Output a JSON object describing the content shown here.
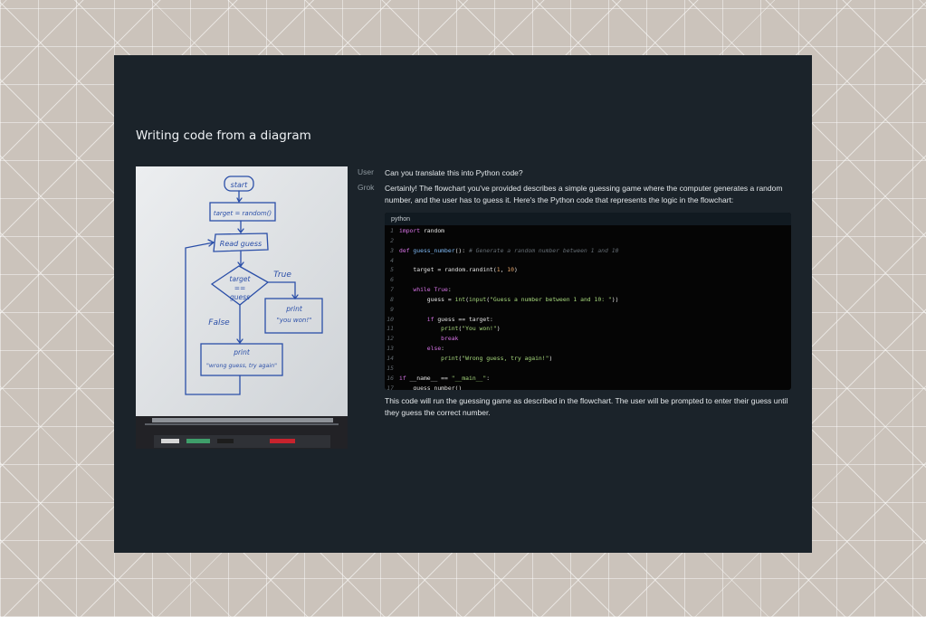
{
  "page": {
    "title": "Writing code from a diagram"
  },
  "chat": {
    "user_role": "User",
    "user_message": "Can you translate this into Python code?",
    "assistant_role": "Grok",
    "assistant_intro": "Certainly! The flowchart you've provided describes a simple guessing game where the computer generates a random number, and the user has to guess it. Here's the Python code that represents the logic in the flowchart:",
    "assistant_outro": "This code will run the guessing game as described in the flowchart. The user will be prompted to enter their guess until they guess the correct number."
  },
  "code_block": {
    "language": "python",
    "lines": [
      {
        "n": "1",
        "text": "import random"
      },
      {
        "n": "2",
        "text": ""
      },
      {
        "n": "3",
        "text": "def guess_number(): # Generate a random number between 1 and 10"
      },
      {
        "n": "4",
        "text": ""
      },
      {
        "n": "5",
        "text": "    target = random.randint(1, 10)"
      },
      {
        "n": "6",
        "text": ""
      },
      {
        "n": "7",
        "text": "    while True:"
      },
      {
        "n": "8",
        "text": "        guess = int(input(\"Guess a number between 1 and 10: \"))"
      },
      {
        "n": "9",
        "text": ""
      },
      {
        "n": "10",
        "text": "        if guess == target:"
      },
      {
        "n": "11",
        "text": "            print(\"You won!\")"
      },
      {
        "n": "12",
        "text": "            break"
      },
      {
        "n": "13",
        "text": "        else:"
      },
      {
        "n": "14",
        "text": "            print(\"Wrong guess, try again!\")"
      },
      {
        "n": "15",
        "text": ""
      },
      {
        "n": "16",
        "text": "if __name__ == \"__main__\":"
      },
      {
        "n": "17",
        "text": "    guess_number()"
      }
    ]
  },
  "whiteboard": {
    "start": "start",
    "assign": "target = random()",
    "read": "Read guess",
    "decision_1": "target",
    "decision_2": "==",
    "decision_3": "guess",
    "true_label": "True",
    "false_label": "False",
    "print_win_1": "print",
    "print_win_2": "\"you won!\"",
    "print_lose_1": "print",
    "print_lose_2": "\"wrong guess, try again\""
  },
  "colors": {
    "panel_bg": "#1b232a",
    "code_bg": "#050505",
    "marker_ink": "#2b4fa8",
    "keyword": "#d773e6",
    "function": "#7db7f2",
    "string": "#a7d97d",
    "number": "#e6a66a"
  }
}
